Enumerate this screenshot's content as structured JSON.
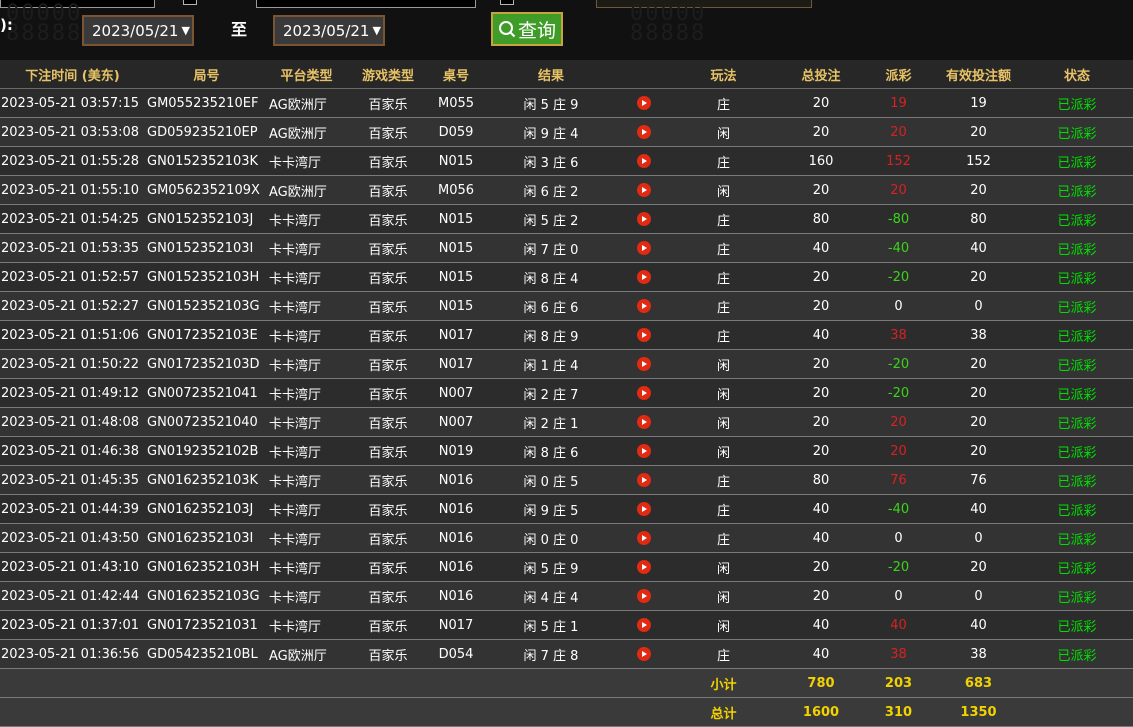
{
  "colors": {
    "header_text": "#e8c266",
    "status_green": "#00e000",
    "payout_red": "#d62222",
    "payout_green": "#3ad418",
    "summary_yellow": "#f2d300",
    "play_icon": "#e02a12",
    "query_button": "#3f9c28"
  },
  "filters": {
    "label_fragment": "):",
    "start_date": "2023/05/21",
    "to_label": "至",
    "end_date": "2023/05/21",
    "caret": "▼",
    "query_label": "查询",
    "query_icon": "search-icon"
  },
  "table": {
    "columns": [
      "下注时间 (美东)",
      "局号",
      "平台类型",
      "游戏类型",
      "桌号",
      "结果",
      "",
      "玩法",
      "总投注",
      "派彩",
      "有效投注额",
      "状态"
    ],
    "rows": [
      {
        "time": "2023-05-21 03:57:15",
        "round": "GM055235210EF",
        "platform": "AG欧洲厅",
        "game": "百家乐",
        "table": "M055",
        "result": "闲 5 庄 9",
        "bet": "庄",
        "total": "20",
        "payout": "19",
        "payout_color": "red",
        "valid": "19",
        "status": "已派彩"
      },
      {
        "time": "2023-05-21 03:53:08",
        "round": "GD059235210EP",
        "platform": "AG欧洲厅",
        "game": "百家乐",
        "table": "D059",
        "result": "闲 9 庄 4",
        "bet": "闲",
        "total": "20",
        "payout": "20",
        "payout_color": "red",
        "valid": "20",
        "status": "已派彩"
      },
      {
        "time": "2023-05-21 01:55:28",
        "round": "GN0152352103K",
        "platform": "卡卡湾厅",
        "game": "百家乐",
        "table": "N015",
        "result": "闲 3 庄 6",
        "bet": "庄",
        "total": "160",
        "payout": "152",
        "payout_color": "red",
        "valid": "152",
        "status": "已派彩"
      },
      {
        "time": "2023-05-21 01:55:10",
        "round": "GM0562352109X",
        "platform": "AG欧洲厅",
        "game": "百家乐",
        "table": "M056",
        "result": "闲 6 庄 2",
        "bet": "闲",
        "total": "20",
        "payout": "20",
        "payout_color": "red",
        "valid": "20",
        "status": "已派彩"
      },
      {
        "time": "2023-05-21 01:54:25",
        "round": "GN0152352103J",
        "platform": "卡卡湾厅",
        "game": "百家乐",
        "table": "N015",
        "result": "闲 5 庄 2",
        "bet": "庄",
        "total": "80",
        "payout": "-80",
        "payout_color": "green",
        "valid": "80",
        "status": "已派彩"
      },
      {
        "time": "2023-05-21 01:53:35",
        "round": "GN0152352103I",
        "platform": "卡卡湾厅",
        "game": "百家乐",
        "table": "N015",
        "result": "闲 7 庄 0",
        "bet": "庄",
        "total": "40",
        "payout": "-40",
        "payout_color": "green",
        "valid": "40",
        "status": "已派彩"
      },
      {
        "time": "2023-05-21 01:52:57",
        "round": "GN0152352103H",
        "platform": "卡卡湾厅",
        "game": "百家乐",
        "table": "N015",
        "result": "闲 8 庄 4",
        "bet": "庄",
        "total": "20",
        "payout": "-20",
        "payout_color": "green",
        "valid": "20",
        "status": "已派彩"
      },
      {
        "time": "2023-05-21 01:52:27",
        "round": "GN0152352103G",
        "platform": "卡卡湾厅",
        "game": "百家乐",
        "table": "N015",
        "result": "闲 6 庄 6",
        "bet": "庄",
        "total": "20",
        "payout": "0",
        "payout_color": "white",
        "valid": "0",
        "status": "已派彩"
      },
      {
        "time": "2023-05-21 01:51:06",
        "round": "GN0172352103E",
        "platform": "卡卡湾厅",
        "game": "百家乐",
        "table": "N017",
        "result": "闲 8 庄 9",
        "bet": "庄",
        "total": "40",
        "payout": "38",
        "payout_color": "red",
        "valid": "38",
        "status": "已派彩"
      },
      {
        "time": "2023-05-21 01:50:22",
        "round": "GN0172352103D",
        "platform": "卡卡湾厅",
        "game": "百家乐",
        "table": "N017",
        "result": "闲 1 庄 4",
        "bet": "闲",
        "total": "20",
        "payout": "-20",
        "payout_color": "green",
        "valid": "20",
        "status": "已派彩"
      },
      {
        "time": "2023-05-21 01:49:12",
        "round": "GN00723521041",
        "platform": "卡卡湾厅",
        "game": "百家乐",
        "table": "N007",
        "result": "闲 2 庄 7",
        "bet": "闲",
        "total": "20",
        "payout": "-20",
        "payout_color": "green",
        "valid": "20",
        "status": "已派彩"
      },
      {
        "time": "2023-05-21 01:48:08",
        "round": "GN00723521040",
        "platform": "卡卡湾厅",
        "game": "百家乐",
        "table": "N007",
        "result": "闲 2 庄 1",
        "bet": "闲",
        "total": "20",
        "payout": "20",
        "payout_color": "red",
        "valid": "20",
        "status": "已派彩"
      },
      {
        "time": "2023-05-21 01:46:38",
        "round": "GN0192352102B",
        "platform": "卡卡湾厅",
        "game": "百家乐",
        "table": "N019",
        "result": "闲 8 庄 6",
        "bet": "闲",
        "total": "20",
        "payout": "20",
        "payout_color": "red",
        "valid": "20",
        "status": "已派彩"
      },
      {
        "time": "2023-05-21 01:45:35",
        "round": "GN0162352103K",
        "platform": "卡卡湾厅",
        "game": "百家乐",
        "table": "N016",
        "result": "闲 0 庄 5",
        "bet": "庄",
        "total": "80",
        "payout": "76",
        "payout_color": "red",
        "valid": "76",
        "status": "已派彩"
      },
      {
        "time": "2023-05-21 01:44:39",
        "round": "GN0162352103J",
        "platform": "卡卡湾厅",
        "game": "百家乐",
        "table": "N016",
        "result": "闲 9 庄 5",
        "bet": "庄",
        "total": "40",
        "payout": "-40",
        "payout_color": "green",
        "valid": "40",
        "status": "已派彩"
      },
      {
        "time": "2023-05-21 01:43:50",
        "round": "GN0162352103I",
        "platform": "卡卡湾厅",
        "game": "百家乐",
        "table": "N016",
        "result": "闲 0 庄 0",
        "bet": "庄",
        "total": "40",
        "payout": "0",
        "payout_color": "white",
        "valid": "0",
        "status": "已派彩"
      },
      {
        "time": "2023-05-21 01:43:10",
        "round": "GN0162352103H",
        "platform": "卡卡湾厅",
        "game": "百家乐",
        "table": "N016",
        "result": "闲 5 庄 9",
        "bet": "闲",
        "total": "20",
        "payout": "-20",
        "payout_color": "green",
        "valid": "20",
        "status": "已派彩"
      },
      {
        "time": "2023-05-21 01:42:44",
        "round": "GN0162352103G",
        "platform": "卡卡湾厅",
        "game": "百家乐",
        "table": "N016",
        "result": "闲 4 庄 4",
        "bet": "闲",
        "total": "20",
        "payout": "0",
        "payout_color": "white",
        "valid": "0",
        "status": "已派彩"
      },
      {
        "time": "2023-05-21 01:37:01",
        "round": "GN01723521031",
        "platform": "卡卡湾厅",
        "game": "百家乐",
        "table": "N017",
        "result": "闲 5 庄 1",
        "bet": "闲",
        "total": "40",
        "payout": "40",
        "payout_color": "red",
        "valid": "40",
        "status": "已派彩"
      },
      {
        "time": "2023-05-21 01:36:56",
        "round": "GD054235210BL",
        "platform": "AG欧洲厅",
        "game": "百家乐",
        "table": "D054",
        "result": "闲 7 庄 8",
        "bet": "庄",
        "total": "40",
        "payout": "38",
        "payout_color": "red",
        "valid": "38",
        "status": "已派彩"
      }
    ],
    "play_icon": "play-icon",
    "subtotal": {
      "label": "小计",
      "total": "780",
      "payout": "203",
      "valid": "683"
    },
    "grandtotal": {
      "label": "总计",
      "total": "1600",
      "payout": "310",
      "valid": "1350"
    }
  }
}
